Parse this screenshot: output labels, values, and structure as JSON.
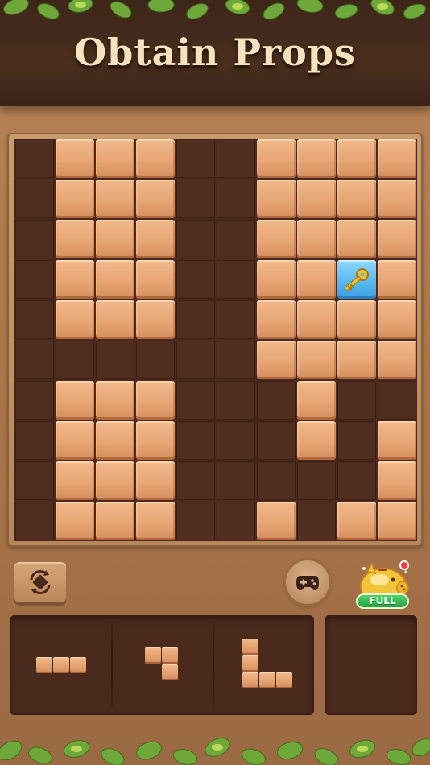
{
  "header": {
    "title": "Obtain Props"
  },
  "board": {
    "size": 10,
    "filled": [
      [
        1,
        2,
        3,
        6,
        7,
        8,
        9
      ],
      [
        1,
        2,
        3,
        6,
        7,
        8,
        9
      ],
      [
        1,
        2,
        3,
        6,
        7,
        8,
        9
      ],
      [
        1,
        2,
        3,
        6,
        7,
        8,
        9
      ],
      [
        1,
        2,
        3,
        6,
        7,
        8,
        9
      ],
      [
        6,
        7,
        8,
        9
      ],
      [
        1,
        2,
        3,
        7
      ],
      [
        1,
        2,
        3,
        7,
        9
      ],
      [
        1,
        2,
        3,
        9
      ],
      [
        1,
        2,
        3,
        6,
        8,
        9
      ]
    ],
    "key_cell": {
      "row": 3,
      "col": 8,
      "icon": "key-icon"
    }
  },
  "controls": {
    "rotate_icon": "rotate-icon",
    "game_icon": "gamepad-icon",
    "piggy_icon": "piggy-bank-icon",
    "piggy_label": "FULL",
    "notification_color": "#ff3b3b"
  },
  "tray": {
    "pieces": [
      {
        "name": "piece-i3-horizontal",
        "cells": [
          [
            0,
            0
          ],
          [
            0,
            1
          ],
          [
            0,
            2
          ]
        ]
      },
      {
        "name": "piece-s-shape",
        "cells": [
          [
            0,
            0
          ],
          [
            0,
            1
          ],
          [
            1,
            1
          ]
        ]
      },
      {
        "name": "piece-l-shape",
        "cells": [
          [
            0,
            0
          ],
          [
            1,
            0
          ],
          [
            2,
            0
          ],
          [
            2,
            1
          ],
          [
            2,
            2
          ]
        ]
      }
    ]
  },
  "colors": {
    "block": "#e8a675",
    "key_block": "#55b8f3",
    "board_empty": "#4f2d1f",
    "header": "#4a2e1e",
    "title_text": "#f6e2bd"
  }
}
